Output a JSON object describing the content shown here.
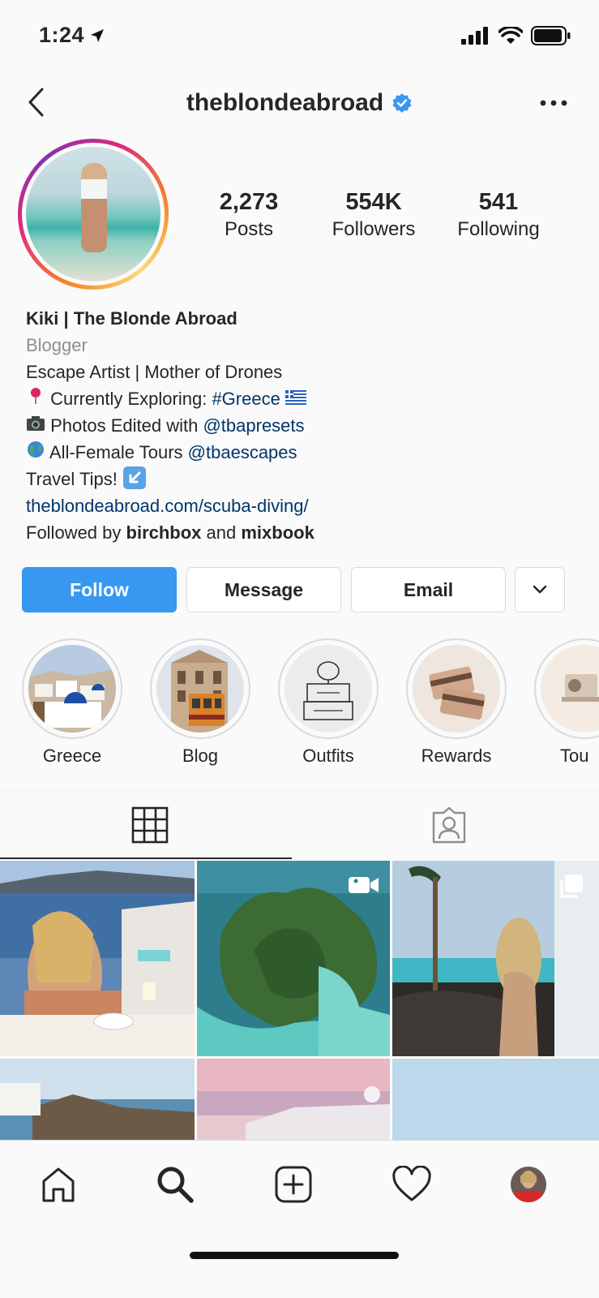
{
  "status": {
    "time": "1:24"
  },
  "header": {
    "username": "theblondeabroad"
  },
  "stats": [
    {
      "value": "2,273",
      "label": "Posts"
    },
    {
      "value": "554K",
      "label": "Followers"
    },
    {
      "value": "541",
      "label": "Following"
    }
  ],
  "bio": {
    "name": "Kiki | The Blonde Abroad",
    "category": "Blogger",
    "line1": "Escape Artist | Mother of Drones",
    "line2_prefix": "Currently Exploring: ",
    "line2_tag": "#Greece",
    "line3_prefix": "Photos Edited with ",
    "line3_mention": "@tbapresets",
    "line4_prefix": "All-Female Tours ",
    "line4_mention": "@tbaescapes",
    "line5": "Travel Tips!",
    "website": "theblondeabroad.com/scuba-diving/",
    "followed_prefix": "Followed by ",
    "followed_user1": "birchbox",
    "followed_and": " and ",
    "followed_user2": "mixbook"
  },
  "buttons": {
    "follow": "Follow",
    "message": "Message",
    "email": "Email"
  },
  "highlights": [
    "Greece",
    "Blog",
    "Outfits",
    "Rewards",
    "Tou"
  ],
  "colors": {
    "accent": "#3897f0",
    "link": "#003569",
    "verified": "#3897f0"
  }
}
